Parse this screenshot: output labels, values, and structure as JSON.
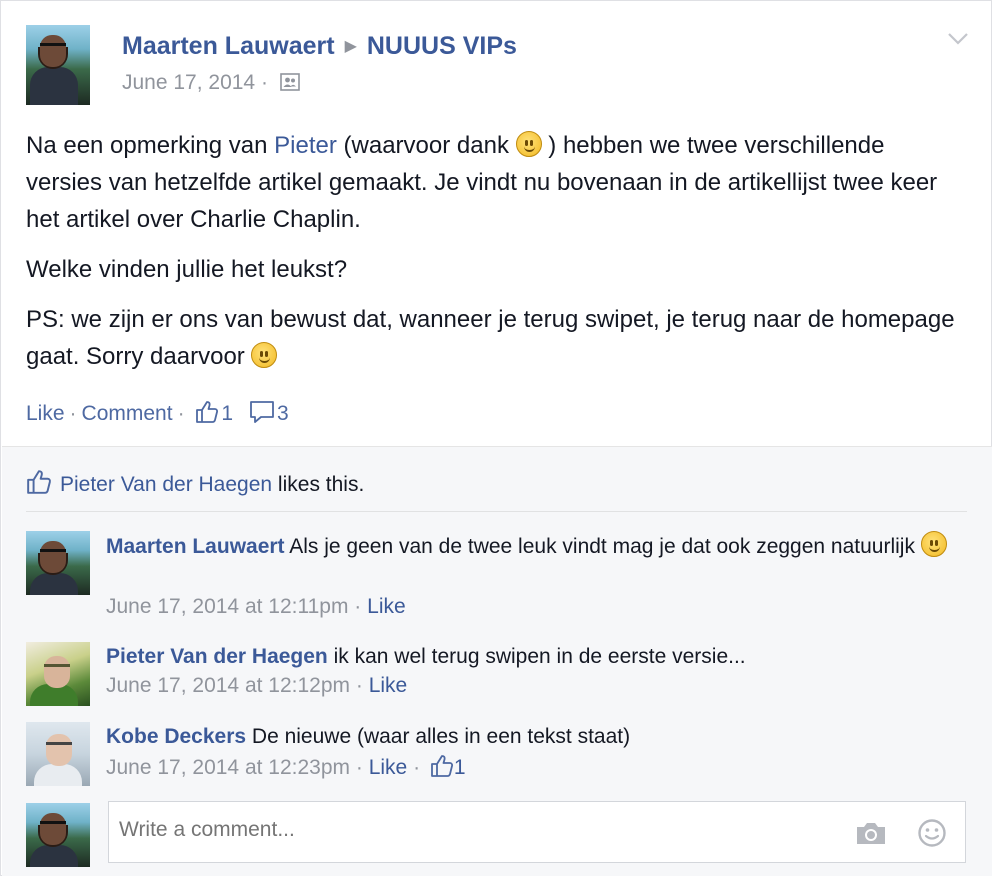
{
  "post": {
    "author": "Maarten Lauwaert",
    "group": "NUUUS VIPs",
    "date": "June 17, 2014",
    "separator": "·",
    "audience_icon": "members-icon",
    "body": {
      "p1_before": "Na een opmerking van ",
      "p1_link": "Pieter",
      "p1_mid": " (waarvoor dank ",
      "p1_after": " ) hebben we twee verschillende versies van hetzelfde artikel gemaakt. Je vindt nu bovenaan in de artikellijst twee keer het artikel over Charlie Chaplin.",
      "p2": "Welke vinden jullie het leukst?",
      "p3_before": "PS: we zijn er ons van bewust dat, wanneer je terug swipet, je terug naar de homepage gaat. Sorry daarvoor "
    },
    "actions": {
      "like": "Like",
      "comment": "Comment",
      "sep": "·",
      "like_count": "1",
      "comment_count": "3"
    }
  },
  "likes_summary": {
    "name": "Pieter Van der Haegen",
    "suffix": " likes this."
  },
  "comments": [
    {
      "author": "Maarten Lauwaert",
      "text": " Als je geen van de twee leuk vindt mag je dat ook zeggen natuurlijk ",
      "time": "June 17, 2014 at 12:11pm",
      "sep": " · ",
      "like": "Like"
    },
    {
      "author": "Pieter Van der Haegen",
      "text": " ik kan wel terug swipen in de eerste versie...",
      "time": "June 17, 2014 at 12:12pm",
      "sep": " · ",
      "like": "Like"
    },
    {
      "author": "Kobe Deckers",
      "text": " De nieuwe (waar alles in een tekst staat)",
      "time": "June 17, 2014 at 12:23pm",
      "sep": " · ",
      "like": "Like",
      "sep2": " · ",
      "like_count": "1"
    }
  ],
  "composer": {
    "placeholder": "Write a comment..."
  },
  "colors": {
    "link": "#3b5998",
    "muted": "#90949c",
    "text": "#141823",
    "ufi_bg": "#f6f7f9"
  }
}
